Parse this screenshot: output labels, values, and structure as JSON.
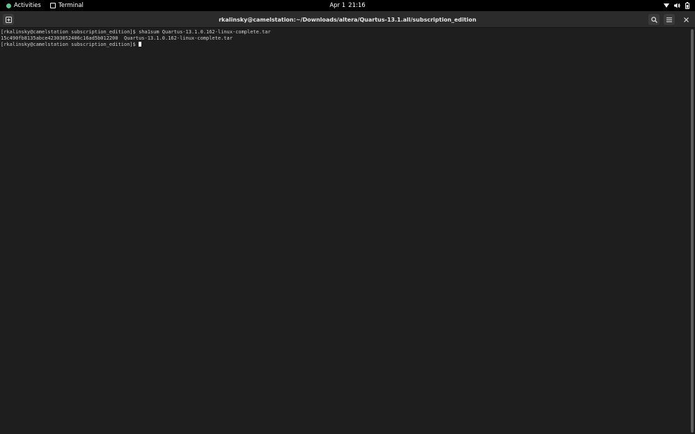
{
  "topbar": {
    "activities_label": "Activities",
    "app_name": "Terminal",
    "clock_date": "Apr 1",
    "clock_time": "21:16",
    "accent_color": "#5cc88d",
    "icons": [
      "network-icon",
      "volume-icon",
      "battery-icon"
    ]
  },
  "window": {
    "title": "rkalinsky@camelstation:~/Downloads/altera/Quartus-13.1.all/subscription_edition",
    "icons": [
      "new-tab-icon",
      "search-icon",
      "hamburger-menu-icon",
      "close-icon"
    ]
  },
  "terminal": {
    "lines": [
      "[rkalinsky@camelstation subscription_edition]$ sha1sum Quartus-13.1.0.162-linux-complete.tar",
      "15c490fb8135abce42303052406c16ad5b012200  Quartus-13.1.0.162-linux-complete.tar"
    ],
    "prompt": "[rkalinsky@camelstation subscription_edition]$ "
  }
}
